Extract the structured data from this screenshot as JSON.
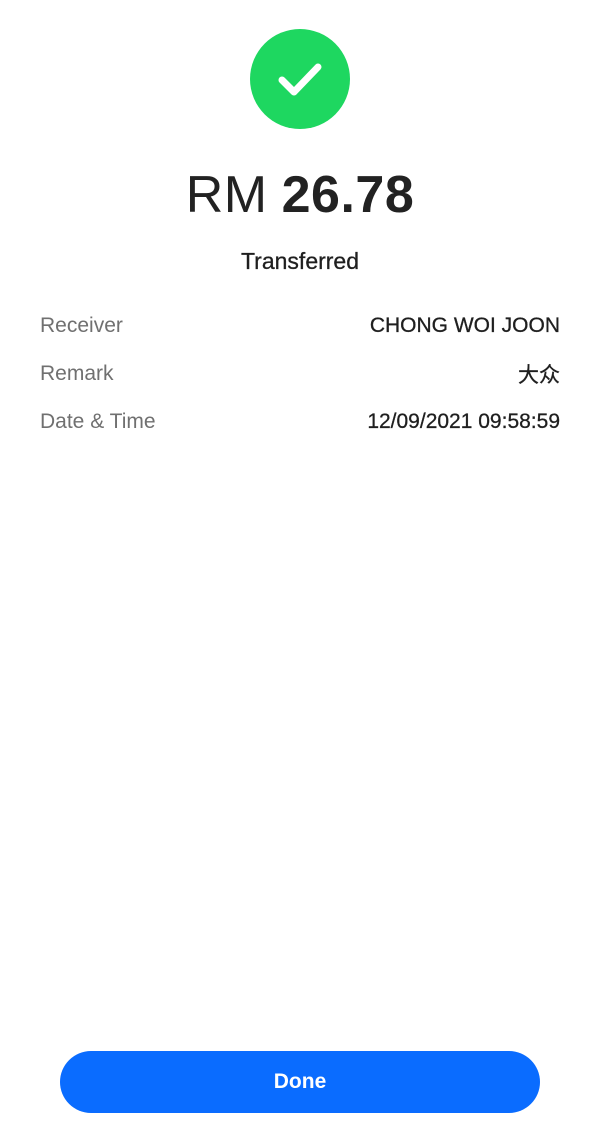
{
  "status_icon": "check-icon",
  "colors": {
    "success": "#1ed760",
    "primary": "#0a6cff"
  },
  "amount": {
    "currency": "RM",
    "value": "26.78"
  },
  "status_text": "Transferred",
  "details": [
    {
      "label": "Receiver",
      "value": "CHONG WOI JOON"
    },
    {
      "label": "Remark",
      "value": "大众"
    },
    {
      "label": "Date & Time",
      "value": "12/09/2021 09:58:59"
    }
  ],
  "done_button": {
    "label": "Done"
  }
}
